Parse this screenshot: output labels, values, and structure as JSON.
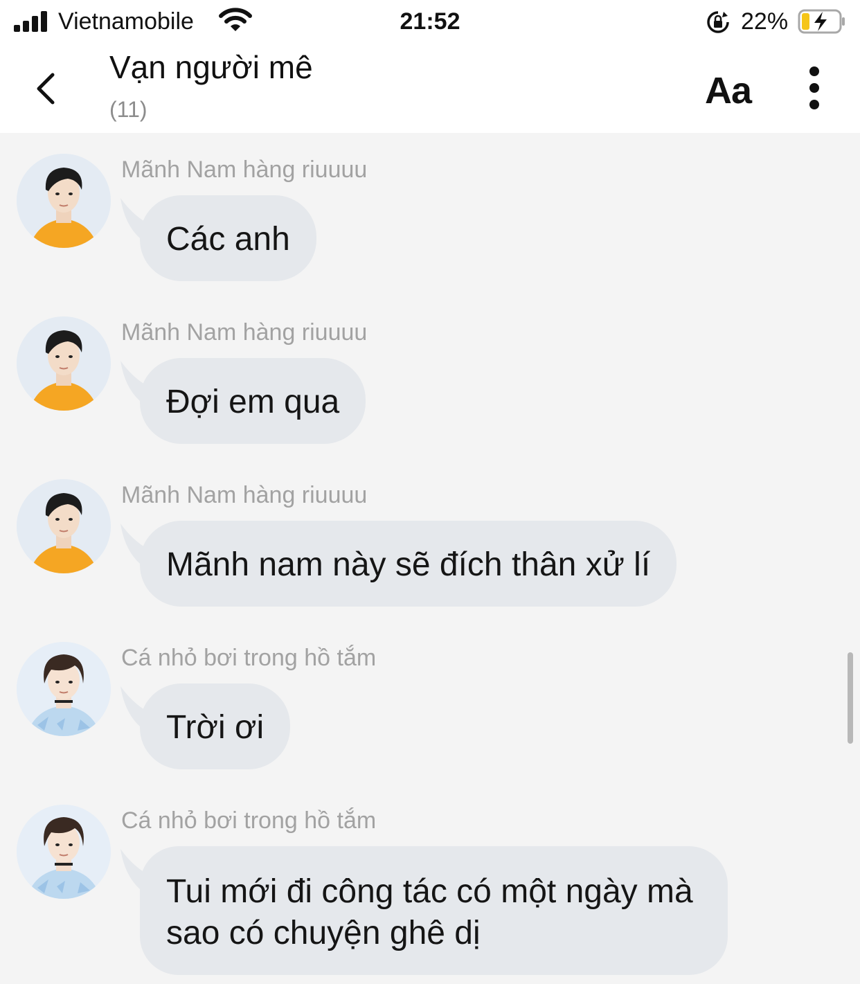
{
  "status_bar": {
    "carrier": "Vietnamobile",
    "time": "21:52",
    "battery_percent": "22%",
    "battery_level": 0.22,
    "battery_color": "#f5c518"
  },
  "header": {
    "title": "Vạn người mê",
    "member_count": "(11)",
    "font_button": "Aa"
  },
  "messages": [
    {
      "sender": "Mãnh Nam hàng riuuuu",
      "lines": [
        "Các anh"
      ]
    },
    {
      "sender": "Mãnh Nam hàng riuuuu",
      "lines": [
        "Đợi em qua"
      ]
    },
    {
      "sender": "Mãnh Nam hàng riuuuu",
      "lines": [
        "Mãnh nam này sẽ đích thân xử lí"
      ]
    },
    {
      "sender": "Cá nhỏ bơi trong hồ tắm",
      "lines": [
        "Trời ơi"
      ]
    },
    {
      "sender": "Cá nhỏ bơi trong hồ tắm",
      "lines": [
        "Tui mới đi công tác có một ngày mà",
        "sao có chuyện ghê dị"
      ]
    }
  ],
  "colors": {
    "background": "#f4f4f4",
    "bubble": "#e5e8ec",
    "sender_text": "#a2a2a2",
    "avatar_one_shirt": "#f5a623",
    "avatar_two_shirt": "#bcd8ef"
  }
}
